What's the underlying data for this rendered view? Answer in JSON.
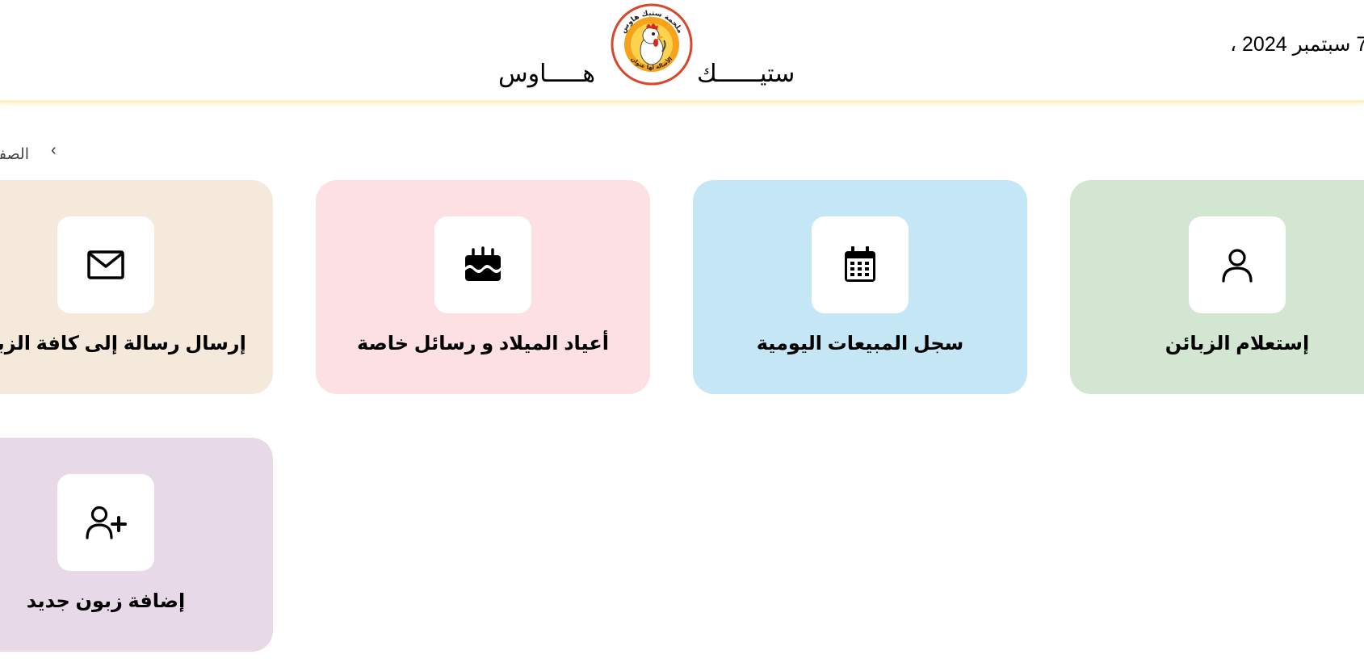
{
  "header": {
    "date": "7 سبتمبر 2024 ،",
    "brand_word_1": "ستيــــــك",
    "brand_word_2": "هـــــاوس",
    "logo_text_top": "ملحمة ستيك هاوس",
    "logo_text_bottom": "الأصالة لها عنوان"
  },
  "breadcrumb": {
    "chevron": "‹",
    "current": "الصفحة"
  },
  "cards": [
    {
      "label": "إستعلام الزبائن",
      "icon": "user-icon",
      "color": "#d3e6d2"
    },
    {
      "label": "سجل المبيعات اليومية",
      "icon": "calendar-icon",
      "color": "#c4e6f5"
    },
    {
      "label": "أعياد الميلاد و رسائل خاصة",
      "icon": "cake-icon",
      "color": "#fde0e4"
    },
    {
      "label": "إرسال رسالة إلى كافة الزبائن",
      "icon": "mail-icon",
      "color": "#f5e9dc"
    },
    {
      "label": "إضافة زبون جديد",
      "icon": "add-user-icon",
      "color": "#e8d9e8"
    }
  ]
}
